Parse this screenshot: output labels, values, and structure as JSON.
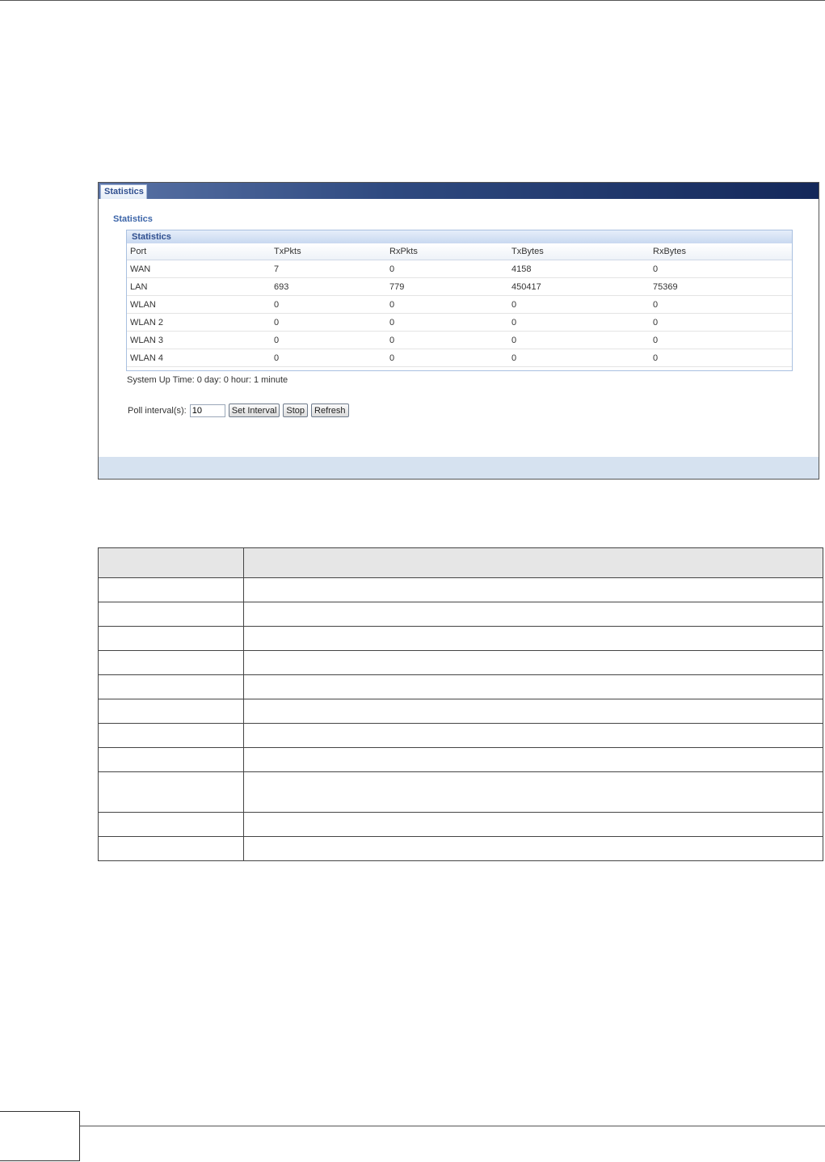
{
  "panel": {
    "tab_label": "Statistics",
    "section_title": "Statistics",
    "box_title": "Statistics",
    "columns": [
      "Port",
      "TxPkts",
      "RxPkts",
      "TxBytes",
      "RxBytes"
    ],
    "rows": [
      [
        "WAN",
        "7",
        "0",
        "4158",
        "0"
      ],
      [
        "LAN",
        "693",
        "779",
        "450417",
        "75369"
      ],
      [
        "WLAN",
        "0",
        "0",
        "0",
        "0"
      ],
      [
        "WLAN 2",
        "0",
        "0",
        "0",
        "0"
      ],
      [
        "WLAN 3",
        "0",
        "0",
        "0",
        "0"
      ],
      [
        "WLAN 4",
        "0",
        "0",
        "0",
        "0"
      ]
    ],
    "uptime": {
      "label": "System Up Time:",
      "day": "0 day:",
      "hour": "0 hour:",
      "minute": "1 minute"
    },
    "poll": {
      "label": "Poll interval(s):",
      "value": "10",
      "set_interval": "Set Interval",
      "stop": "Stop",
      "refresh": "Refresh"
    }
  },
  "colors": {
    "tabbar_dark": "#14285a",
    "accent_blue": "#3b64a8",
    "footer_bar": "#d6e2f0"
  }
}
